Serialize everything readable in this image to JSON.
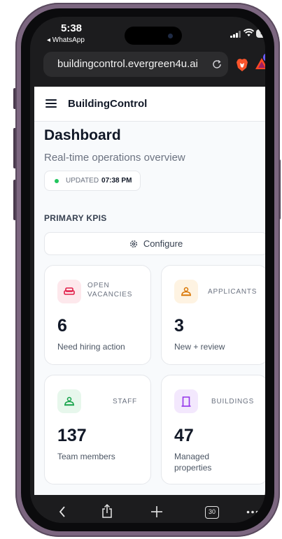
{
  "status_bar": {
    "time": "5:38",
    "back_app": "◂ WhatsApp",
    "battery": "42"
  },
  "browser": {
    "url": "buildingcontrol.evergreen4u.ai",
    "badge_count": "2",
    "tabs_count": "30"
  },
  "app": {
    "brand": "BuildingControl",
    "title": "Dashboard",
    "subtitle": "Real-time operations overview",
    "updated_label": "UPDATED",
    "updated_time": "07:38 PM",
    "section_label": "PRIMARY KPIS",
    "configure_label": "Configure"
  },
  "kpis": [
    {
      "label_line1": "OPEN",
      "label_line2": "VACANCIES",
      "value": "6",
      "desc": "Need hiring action",
      "icon": "sofa-icon",
      "color": "#e11d48",
      "bg": "#fde8ec"
    },
    {
      "label_line1": "APPLICANTS",
      "value": "3",
      "desc": "New + review",
      "icon": "person-icon",
      "color": "#d97706",
      "bg": "#fef3e2"
    },
    {
      "label_line1": "STAFF",
      "value": "137",
      "desc": "Team members",
      "icon": "person-icon",
      "color": "#16a34a",
      "bg": "#e7f7ec"
    },
    {
      "label_line1": "BUILDINGS",
      "value": "47",
      "desc_line1": "Managed",
      "desc_line2": "properties",
      "icon": "door-icon",
      "color": "#9333ea",
      "bg": "#f3e8fd"
    }
  ]
}
